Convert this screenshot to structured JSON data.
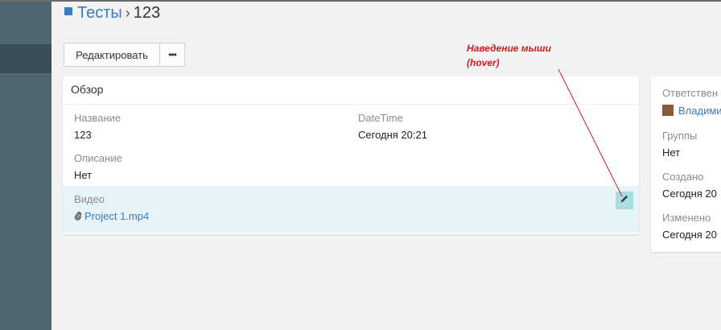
{
  "page": {
    "title_section": "Тесты",
    "breadcrumb_sep": "›",
    "title_item": "123"
  },
  "toolbar": {
    "edit_label": "Редактировать",
    "more_label": "•••"
  },
  "overview": {
    "title": "Обзор",
    "fields": {
      "name_label": "Название",
      "name_value": "123",
      "datetime_label": "DateTime",
      "datetime_value": "Сегодня 20:21",
      "description_label": "Описание",
      "description_value": "Нет",
      "video_label": "Видео",
      "video_value": "Project 1.mp4"
    }
  },
  "side_panel": {
    "responsible_label": "Ответствен",
    "responsible_value": "Владими",
    "groups_label": "Группы",
    "groups_value": "Нет",
    "created_label": "Создано",
    "created_value": "Сегодня 20",
    "modified_label": "Изменено",
    "modified_value": "Сегодня 20"
  },
  "annotation": {
    "line1": "Наведение мыши",
    "line2": "(hover)"
  },
  "colors": {
    "sidebar": "#4f6670",
    "link": "#3b7bbf",
    "hover_row": "#e6f3f7",
    "edit_button": "#a9dde3",
    "annotation": "#cc1f1f"
  },
  "icons": {
    "clip": "paperclip-icon",
    "edit": "pencil-icon",
    "title": "square-icon"
  }
}
